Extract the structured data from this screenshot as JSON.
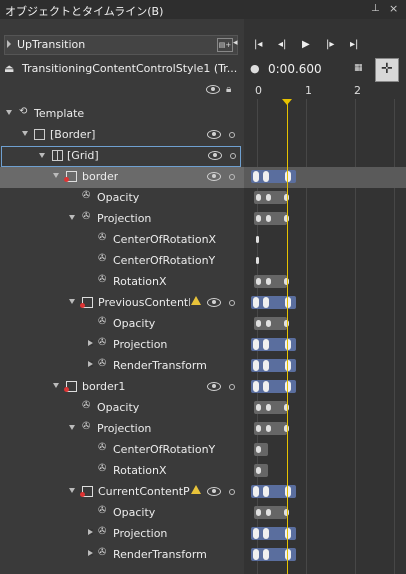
{
  "panel": {
    "title": "オブジェクトとタイムライン(B)",
    "pin_glyph": "⊥",
    "close_glyph": "×"
  },
  "storyboard": {
    "name": "UpTransition",
    "button_label": "▤+"
  },
  "style": {
    "label": "TransitioningContentControlStyle1 (Tr..."
  },
  "timeline": {
    "timecode": "0:00.600",
    "ruler": [
      "0",
      "1",
      "2"
    ]
  },
  "tree": [
    {
      "label": "Template"
    },
    {
      "label": "[Border]"
    },
    {
      "label": "[Grid]"
    },
    {
      "label": "border"
    },
    {
      "label": "Opacity"
    },
    {
      "label": "Projection"
    },
    {
      "label": "CenterOfRotationX"
    },
    {
      "label": "CenterOfRotationY"
    },
    {
      "label": "RotationX"
    },
    {
      "label": "PreviousContentP"
    },
    {
      "label": "Opacity"
    },
    {
      "label": "Projection"
    },
    {
      "label": "RenderTransform"
    },
    {
      "label": "border1"
    },
    {
      "label": "Opacity"
    },
    {
      "label": "Projection"
    },
    {
      "label": "CenterOfRotationY"
    },
    {
      "label": "RotationX"
    },
    {
      "label": "CurrentContentP"
    },
    {
      "label": "Opacity"
    },
    {
      "label": "Projection"
    },
    {
      "label": "RenderTransform"
    }
  ],
  "colors": {
    "accent_blue": "#5a6e9e",
    "playhead": "#e6c200",
    "selection": "#6a6a6a"
  }
}
